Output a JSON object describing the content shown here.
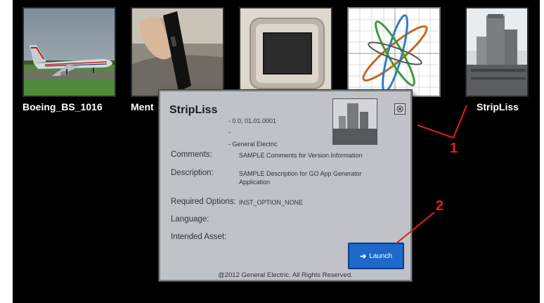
{
  "apps": [
    {
      "label": "Boeing_BS_1016",
      "icon": "airplane-image"
    },
    {
      "label": "Ment",
      "icon": "hand-probe-image"
    },
    {
      "label": "",
      "icon": "tablet-device-image"
    },
    {
      "label": "",
      "icon": "lissajous-plot-image"
    },
    {
      "label": "StripLiss",
      "icon": "industrial-plant-image"
    }
  ],
  "dialog": {
    "title": "StripLiss",
    "version": "- 0.0, 01.01.0001",
    "dash": "-",
    "vendor": "- General Electric",
    "fields": [
      {
        "label": "Comments:",
        "value": "SAMPLE Comments for Version Information"
      },
      {
        "label": "Description:",
        "value": "SAMPLE Description for GO App Generator Application"
      },
      {
        "label": "Required Options:",
        "value": "INST_OPTION_NONE"
      },
      {
        "label": "Language:",
        "value": ""
      },
      {
        "label": "Intended Asset:",
        "value": ""
      }
    ],
    "launch_label": "Launch",
    "copyright": "@2012 General Electric. All Rights Reserved."
  },
  "callouts": {
    "one": "1",
    "two": "2",
    "color": "#e3201c"
  },
  "colors": {
    "accent": "#1e68c9",
    "dialog_bg": "#bfc2c6",
    "background": "#000000"
  }
}
